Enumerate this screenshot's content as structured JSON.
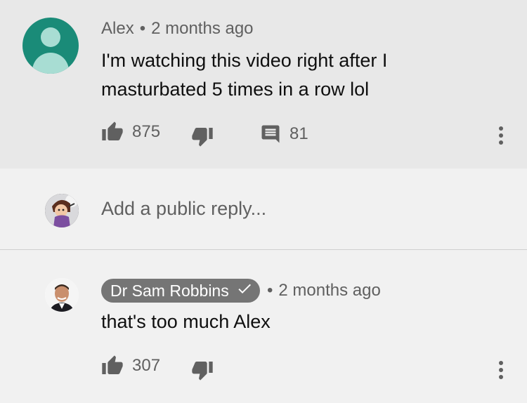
{
  "comment": {
    "author": "Alex",
    "time": "2 months ago",
    "separator": "•",
    "text": "I'm watching this video right after I masturbated 5 times in a row lol",
    "likes": "875",
    "replies": "81"
  },
  "reply_box": {
    "placeholder": "Add a public reply..."
  },
  "reply": {
    "author": "Dr Sam Robbins",
    "verified": true,
    "time": "2 months ago",
    "separator": "•",
    "text": "that's too much Alex",
    "likes": "307"
  },
  "icons": [
    "person-icon",
    "thumbs-up-icon",
    "thumbs-down-icon",
    "reply-icon",
    "more-vert-icon",
    "verified-check-icon"
  ],
  "colors": {
    "top_comment_bg": "#e8e8e8",
    "page_bg": "#f1f1f1",
    "avatar_teal": "#1a8b78",
    "secondary_text": "#606060",
    "author_chip": "#757575"
  }
}
